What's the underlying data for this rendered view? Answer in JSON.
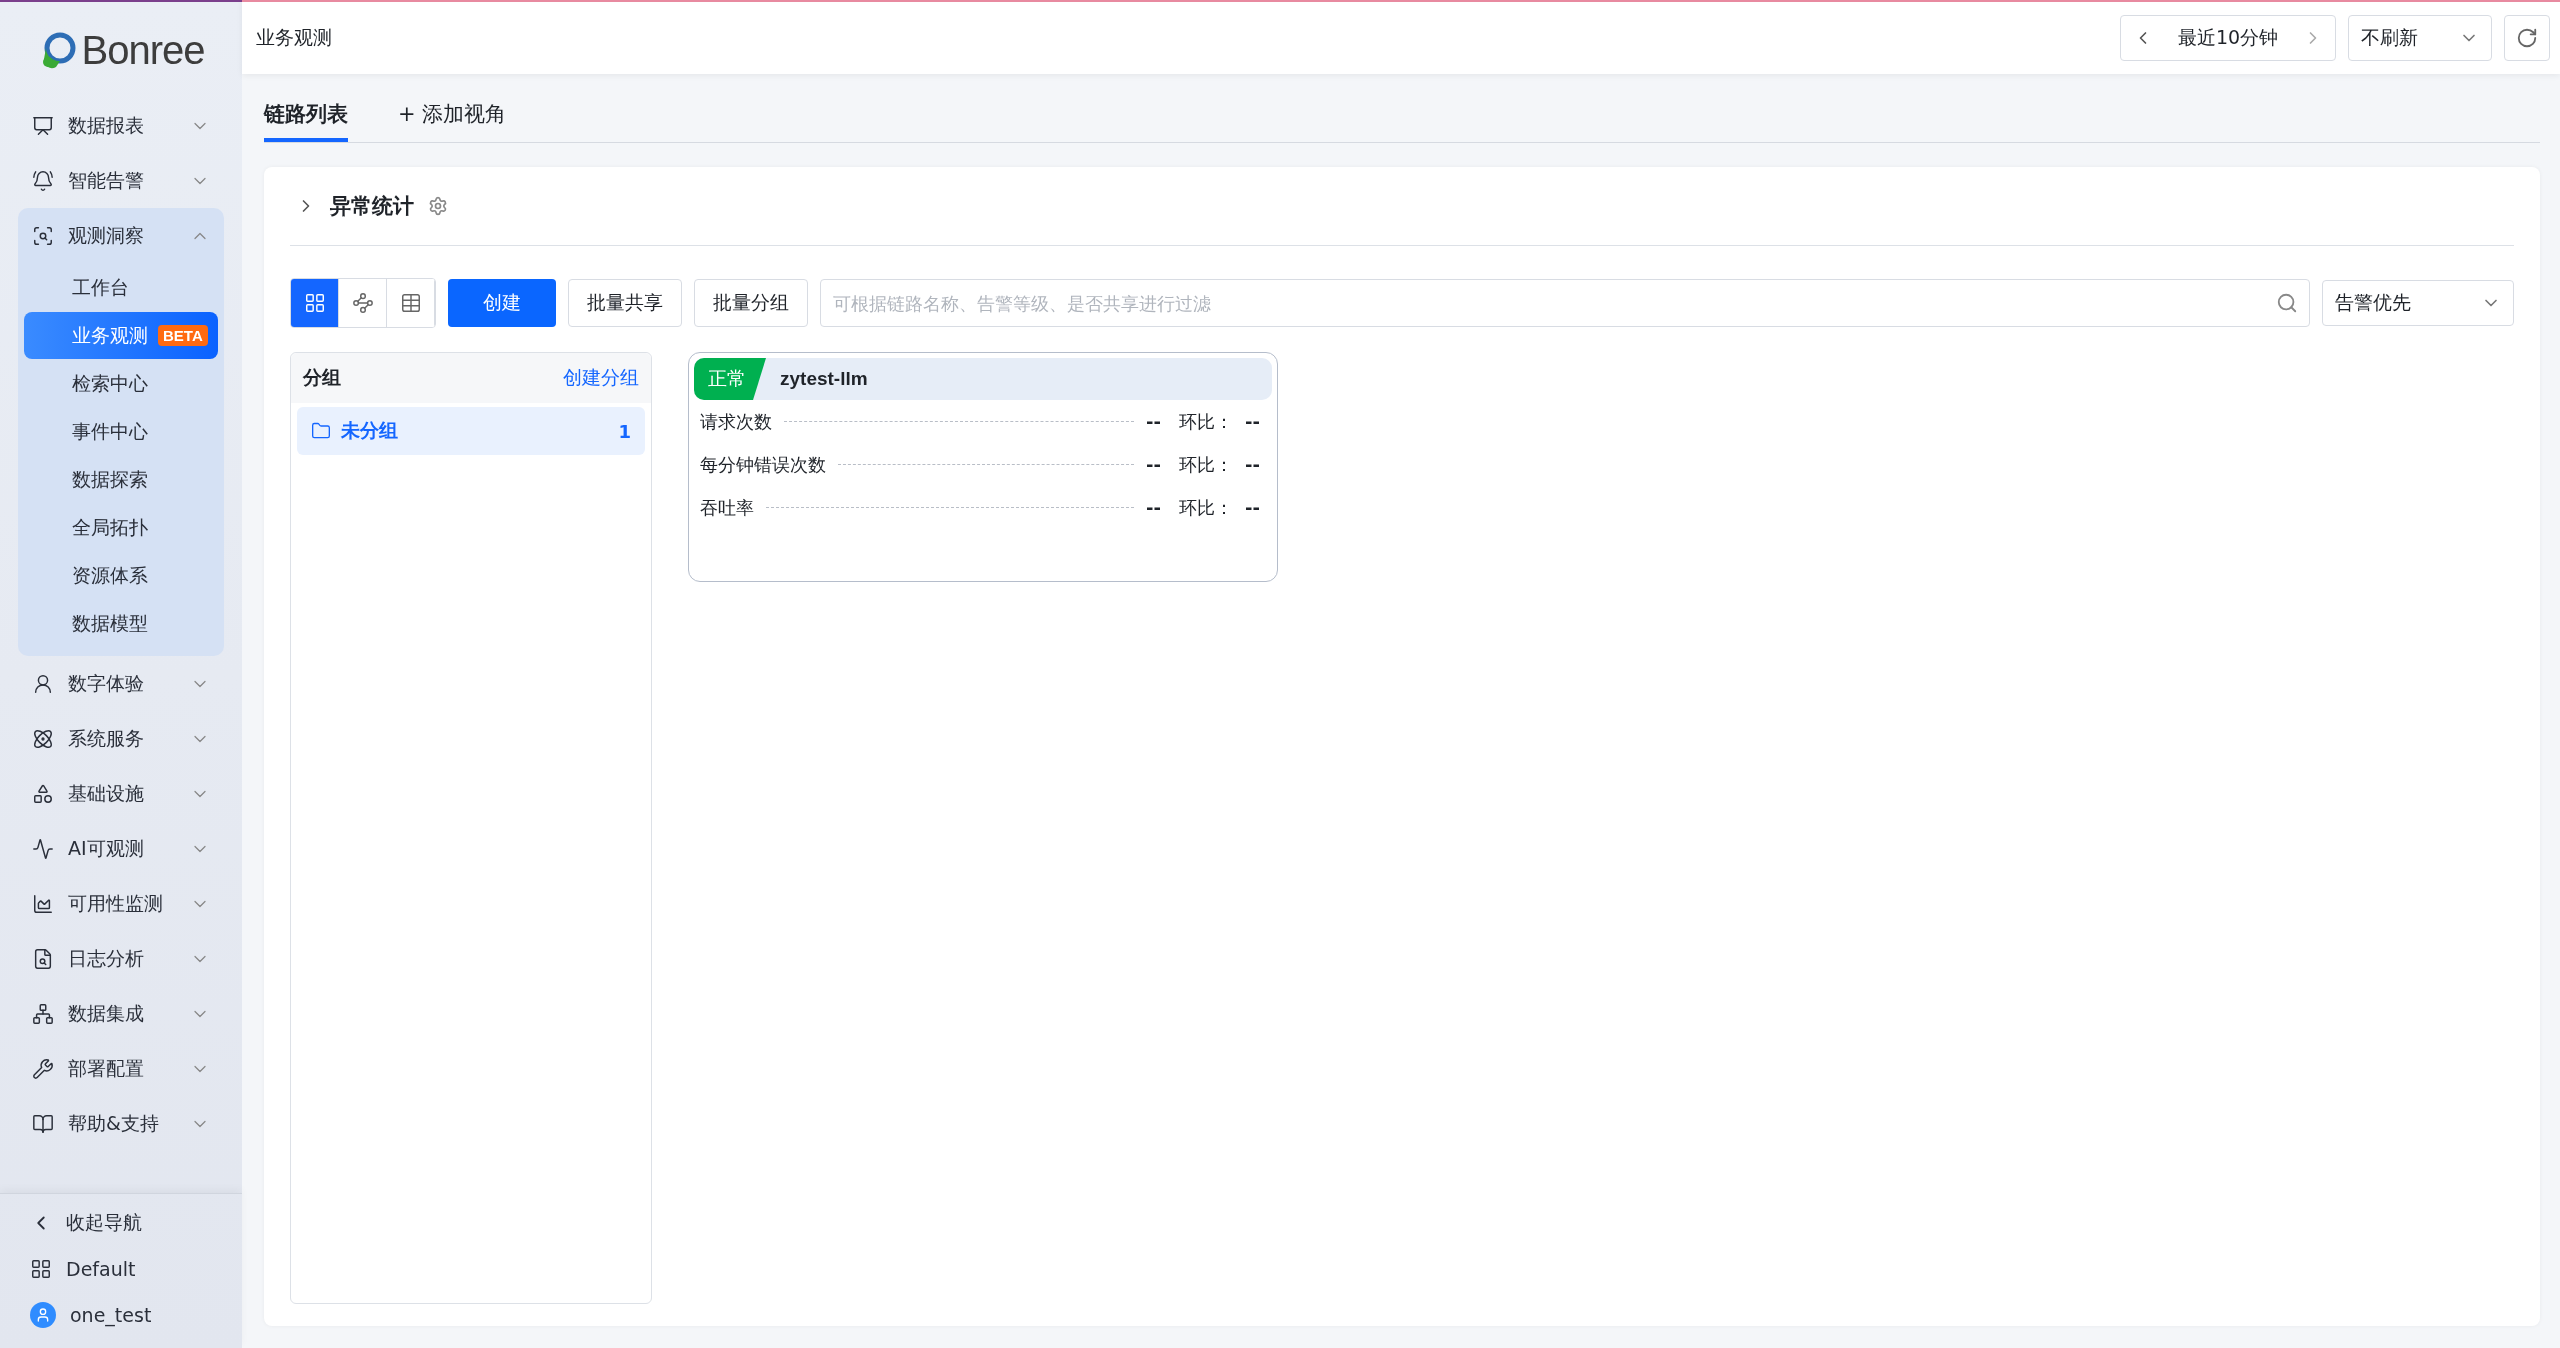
{
  "sidebar": {
    "logo": "Bonree",
    "items": [
      {
        "label": "数据报表",
        "expanded": false
      },
      {
        "label": "智能告警",
        "expanded": false
      },
      {
        "label": "观测洞察",
        "expanded": true,
        "children": [
          {
            "label": "工作台",
            "selected": false
          },
          {
            "label": "业务观测",
            "selected": true,
            "badge": "BETA"
          },
          {
            "label": "检索中心",
            "selected": false
          },
          {
            "label": "事件中心",
            "selected": false
          },
          {
            "label": "数据探索",
            "selected": false
          },
          {
            "label": "全局拓扑",
            "selected": false
          },
          {
            "label": "资源体系",
            "selected": false
          },
          {
            "label": "数据模型",
            "selected": false
          }
        ]
      },
      {
        "label": "数字体验",
        "expanded": false
      },
      {
        "label": "系统服务",
        "expanded": false
      },
      {
        "label": "基础设施",
        "expanded": false
      },
      {
        "label": "AI可观测",
        "expanded": false
      },
      {
        "label": "可用性监测",
        "expanded": false
      },
      {
        "label": "日志分析",
        "expanded": false
      },
      {
        "label": "数据集成",
        "expanded": false
      },
      {
        "label": "部署配置",
        "expanded": false
      },
      {
        "label": "帮助&支持",
        "expanded": false
      }
    ],
    "footer": [
      {
        "label": "收起导航"
      },
      {
        "label": "Default"
      },
      {
        "label": "one_test"
      }
    ]
  },
  "header": {
    "title": "业务观测",
    "time_range": "最近10分钟",
    "refresh": "不刷新"
  },
  "tabs": [
    {
      "label": "链路列表",
      "selected": true
    },
    {
      "label": "+ 添加视角",
      "selected": false
    }
  ],
  "section": {
    "title": "异常统计",
    "expanded": false
  },
  "toolbar": {
    "views": [
      {
        "selected": true
      },
      {
        "selected": false
      },
      {
        "selected": false
      }
    ],
    "create": "创建",
    "buttons": [
      "批量共享",
      "批量分组"
    ],
    "search_placeholder": "可根据链路名称、告警等级、是否共享进行过滤",
    "sort": "告警优先"
  },
  "groups": {
    "title": "分组",
    "action": "创建分组",
    "items": [
      {
        "label": "未分组",
        "count": "1",
        "selected": true
      }
    ]
  },
  "cards": [
    {
      "status": "正常",
      "color": "#00b050",
      "name": "zytest-llm",
      "metrics": [
        {
          "label": "请求次数",
          "value": "--",
          "ratio_label": "环比：",
          "ratio": "--"
        },
        {
          "label": "每分钟错误次数",
          "value": "--",
          "ratio_label": "环比：",
          "ratio": "--"
        },
        {
          "label": "吞吐率",
          "value": "--",
          "ratio_label": "环比：",
          "ratio": "--"
        }
      ]
    }
  ]
}
